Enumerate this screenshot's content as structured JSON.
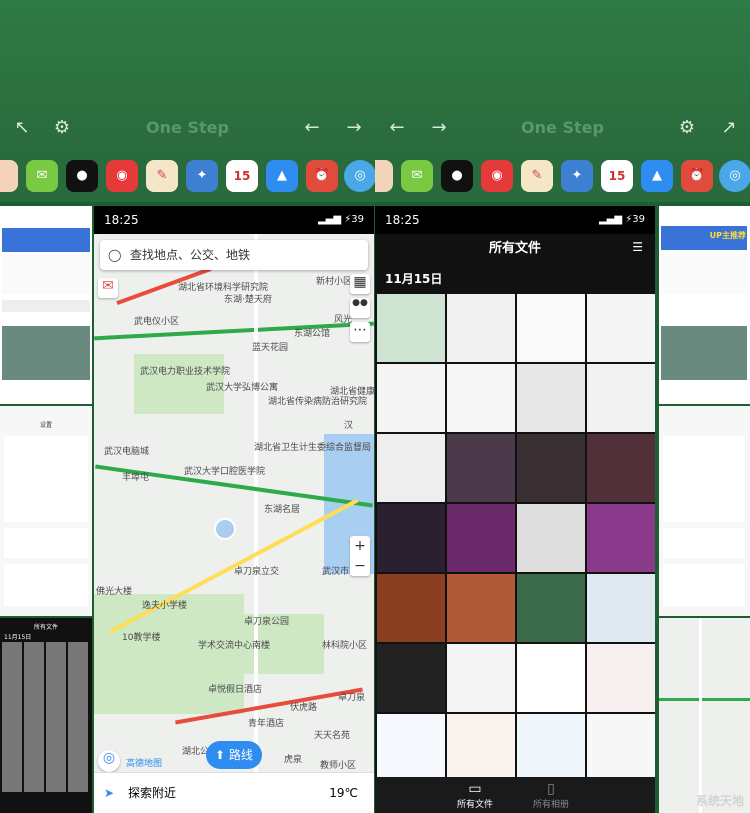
{
  "left_panel": {
    "title": "One Step",
    "map_screen": {
      "time": "18:25",
      "notif_count": "2",
      "battery": "39",
      "search_placeholder": "查找地点、公交、地铁",
      "labels": [
        "新村小区",
        "湖北省环境科学研究院",
        "东湖·楚天府",
        "武电仪小区",
        "东湖公馆",
        "蓝天花园",
        "武汉电力职业技术学院",
        "武汉大学弘博公寓",
        "湖北省传染病防治研究院",
        "湖北省卫生计生委综合监督局",
        "湖北省健康委",
        "武汉电脑城",
        "丰埠屯",
        "武汉大学口腔医学院",
        "东湖名居",
        "卓刀泉立交",
        "卓刀泉公园",
        "武汉市",
        "逸夫小学楼",
        "10教学楼",
        "学术交流中心南楼",
        "林科院小区",
        "卓刀泉",
        "卓悦假日酒店",
        "青年酒店",
        "伏虎路",
        "天天名苑",
        "湖北公馆",
        "虎泉",
        "教师小区",
        "佛光大楼",
        "汉",
        "风光"
      ],
      "route_label": "路线",
      "nearby_label": "探索附近",
      "temperature": "19℃",
      "logo_text": "高德地图"
    }
  },
  "right_panel": {
    "title": "One Step",
    "files_screen": {
      "time": "18:25",
      "notif_count": "2",
      "battery": "39",
      "header": "所有文件",
      "date": "11月15日",
      "tab_all": "所有文件",
      "tab_albums": "所有相册"
    }
  },
  "side_thumb": {
    "banner_text": "UP主推荐",
    "settings_title": "设置",
    "files_mini_title": "所有文件",
    "files_mini_date": "11月15日"
  },
  "watermark": "系统天地",
  "calendar_day": "15"
}
